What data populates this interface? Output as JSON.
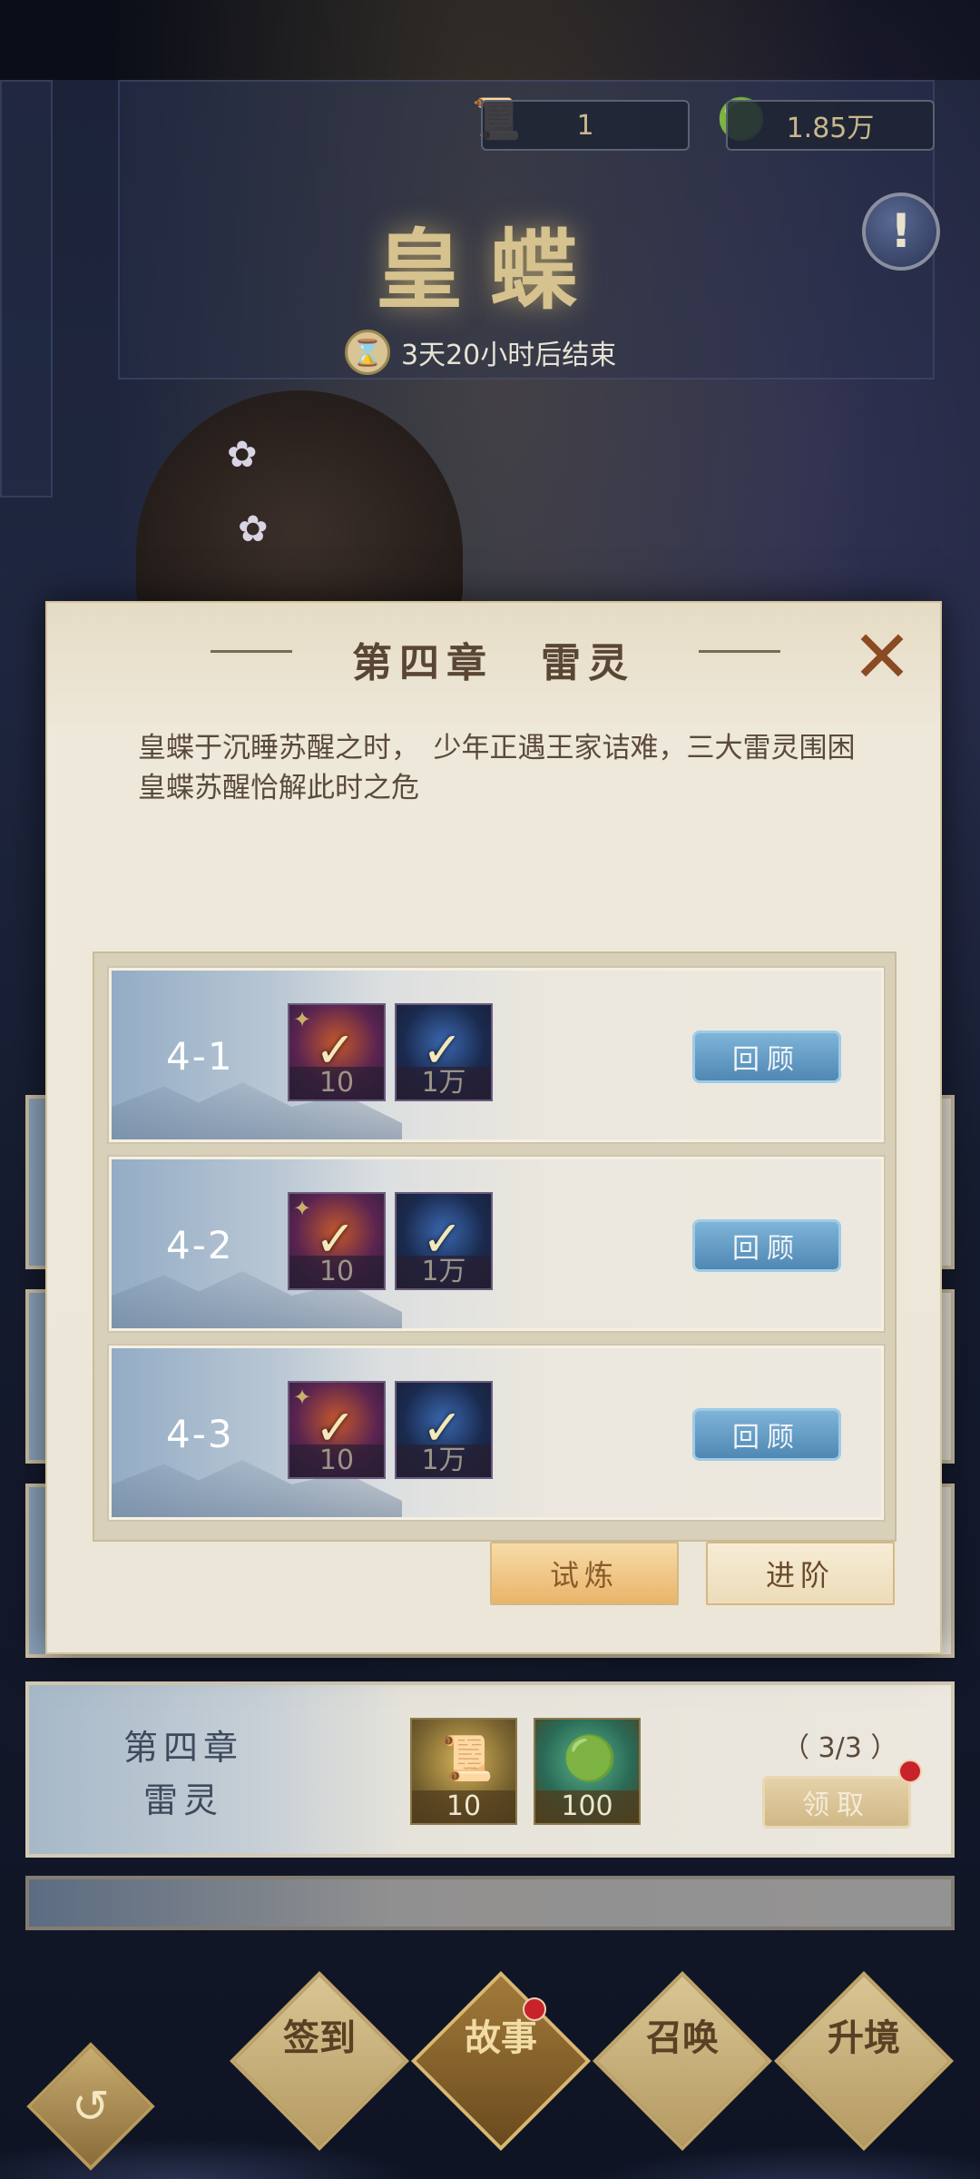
{
  "header": {
    "currency1": {
      "icon": "scroll-icon",
      "value": "1"
    },
    "currency2": {
      "icon": "jade-coin-icon",
      "value": "1.85万"
    },
    "event_title": "皇蝶",
    "timer_text": "3天20小时后结束"
  },
  "dialog": {
    "title": "第四章　雷灵",
    "description": "皇蝶于沉睡苏醒之时，　少年正遇王家诘难，三大雷灵围困　皇蝶苏醒恰解此时之危",
    "stages": [
      {
        "label": "4-1",
        "rewards": [
          {
            "type": "fire-orb-icon",
            "count": "10",
            "completed": true
          },
          {
            "type": "crystal-icon",
            "count": "1万",
            "completed": true
          }
        ],
        "review_label": "回顾"
      },
      {
        "label": "4-2",
        "rewards": [
          {
            "type": "fire-orb-icon",
            "count": "10",
            "completed": true
          },
          {
            "type": "crystal-icon",
            "count": "1万",
            "completed": true
          }
        ],
        "review_label": "回顾"
      },
      {
        "label": "4-3",
        "rewards": [
          {
            "type": "fire-orb-icon",
            "count": "10",
            "completed": true
          },
          {
            "type": "crystal-icon",
            "count": "1万",
            "completed": true
          }
        ],
        "review_label": "回顾"
      }
    ],
    "trial_label": "试炼",
    "advance_label": "进阶"
  },
  "chapter_row": {
    "name_line1": "第四章",
    "name_line2": "雷灵",
    "rewards": [
      {
        "type": "scroll-icon",
        "count": "10"
      },
      {
        "type": "jade-coin-icon",
        "count": "100"
      }
    ],
    "progress": "（ 3/3 ）",
    "claim_label": "领取"
  },
  "bottom_nav": {
    "items": [
      {
        "label": "签到",
        "active": false
      },
      {
        "label": "故事",
        "active": true
      },
      {
        "label": "召唤",
        "active": false
      },
      {
        "label": "升境",
        "active": false
      }
    ]
  },
  "colors": {
    "accent_gold": "#d6c28e",
    "review_blue": "#4f88b4",
    "badge_red": "#c8222a"
  }
}
